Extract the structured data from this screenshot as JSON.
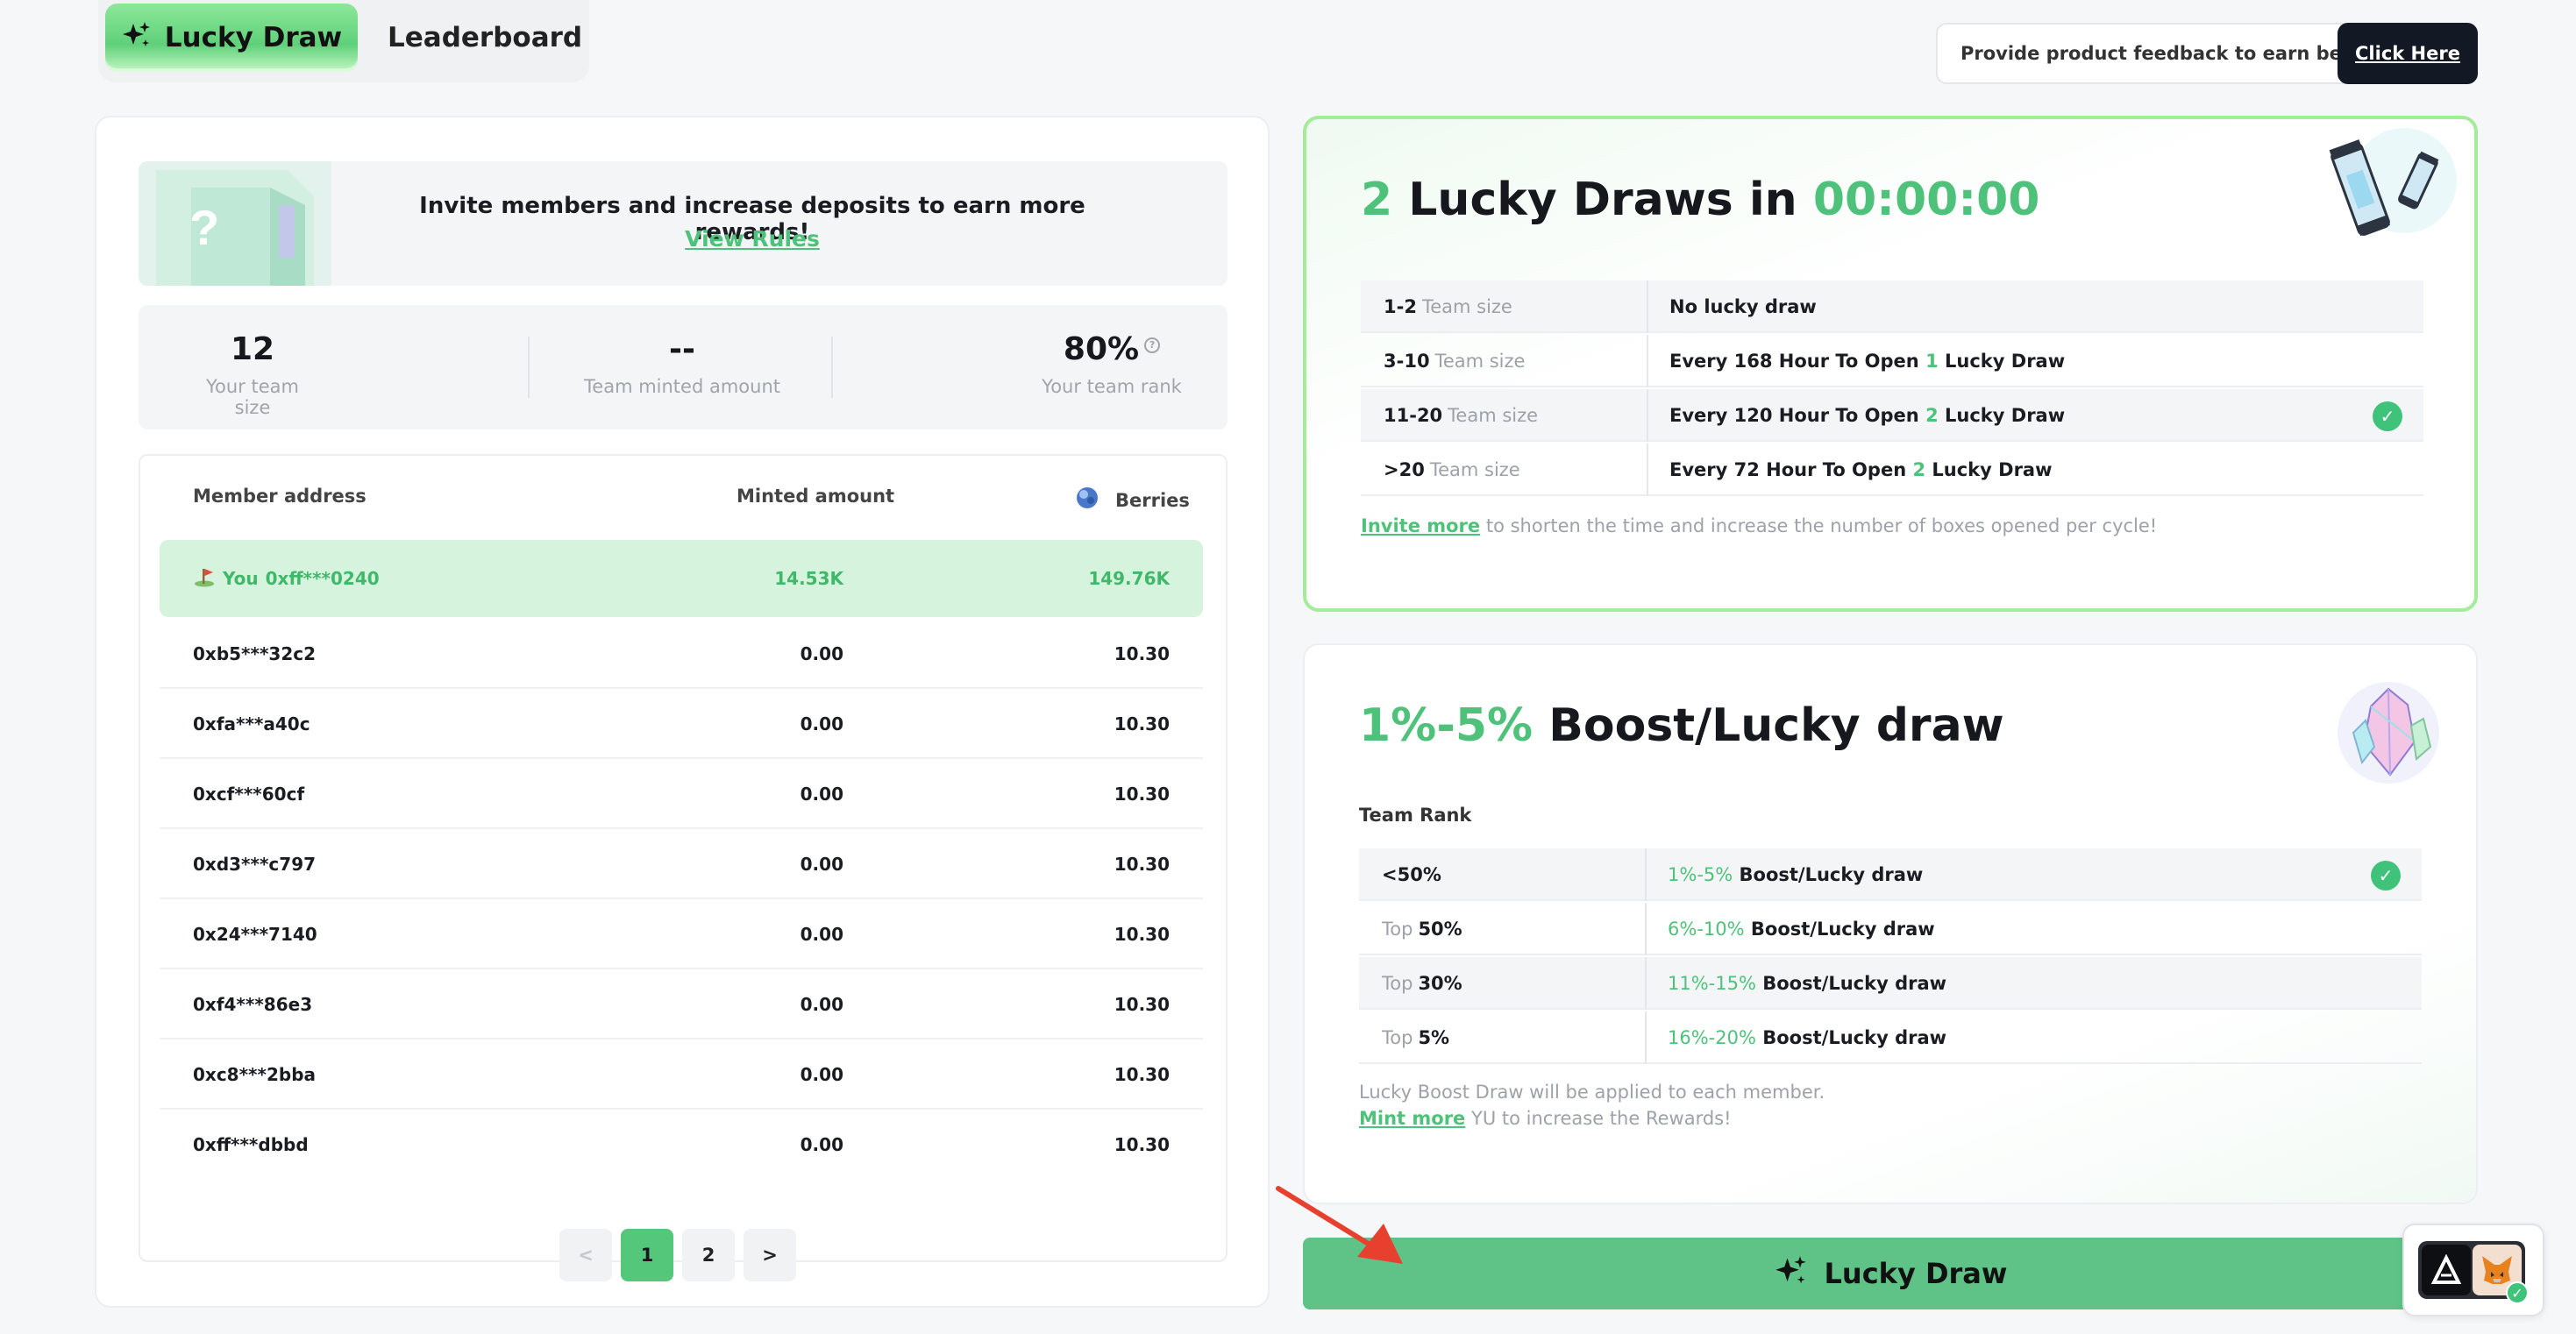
{
  "tabs": [
    {
      "label": "Lucky Draw",
      "icon": "sparkle-icon",
      "active": true
    },
    {
      "label": "Leaderboard",
      "active": false
    }
  ],
  "feedback": {
    "text": "Provide product feedback to earn berries!",
    "button": "Click Here"
  },
  "invite": {
    "text": "Invite members and increase deposits to earn more rewards!",
    "link": "View Rules"
  },
  "stats": [
    {
      "value": "12",
      "label": "Your team size"
    },
    {
      "value": "--",
      "label": "Team minted amount"
    },
    {
      "value": "80%",
      "label": "Your team rank",
      "icon": "info-icon"
    }
  ],
  "members_table": {
    "headers": {
      "address": "Member address",
      "minted": "Minted amount",
      "berries": "Berries",
      "berries_icon": "berry-icon"
    },
    "current_user": {
      "prefix": "You",
      "address": "0xff***0240",
      "minted": "14.53K",
      "berries": "149.76K",
      "icon": "flag-icon"
    },
    "rows": [
      {
        "address": "0xb5***32c2",
        "minted": "0.00",
        "berries": "10.30"
      },
      {
        "address": "0xfa***a40c",
        "minted": "0.00",
        "berries": "10.30"
      },
      {
        "address": "0xcf***60cf",
        "minted": "0.00",
        "berries": "10.30"
      },
      {
        "address": "0xd3***c797",
        "minted": "0.00",
        "berries": "10.30"
      },
      {
        "address": "0x24***7140",
        "minted": "0.00",
        "berries": "10.30"
      },
      {
        "address": "0xf4***86e3",
        "minted": "0.00",
        "berries": "10.30"
      },
      {
        "address": "0xc8***2bba",
        "minted": "0.00",
        "berries": "10.30"
      },
      {
        "address": "0xff***dbbd",
        "minted": "0.00",
        "berries": "10.30"
      }
    ],
    "pagination": {
      "prev": "<",
      "pages": [
        "1",
        "2"
      ],
      "current": "1",
      "next": ">"
    }
  },
  "lucky_draws": {
    "count": "2",
    "title_mid": "Lucky Draws in",
    "countdown": "00:00:00",
    "rows": [
      {
        "range": "1-2",
        "unit": "Team size",
        "before": "No lucky draw",
        "num": "",
        "after": "",
        "checked": false
      },
      {
        "range": "3-10",
        "unit": "Team size",
        "before": "Every 168 Hour To Open",
        "num": "1",
        "after": "Lucky Draw",
        "checked": false
      },
      {
        "range": "11-20",
        "unit": "Team size",
        "before": "Every 120 Hour To Open",
        "num": "2",
        "after": "Lucky Draw",
        "checked": true
      },
      {
        "range": ">20",
        "unit": "Team size",
        "before": "Every 72 Hour To Open",
        "num": "2",
        "after": "Lucky Draw",
        "checked": false
      }
    ],
    "note_link": "Invite more",
    "note_text": "to shorten the time and increase the number of boxes opened per cycle!"
  },
  "boost": {
    "range": "1%-5%",
    "title": "Boost/Lucky draw",
    "section_label": "Team Rank",
    "rows": [
      {
        "pre": "",
        "rank": "<50%",
        "pct": "1%-5%",
        "text": "Boost/Lucky draw",
        "checked": true
      },
      {
        "pre": "Top",
        "rank": "50%",
        "pct": "6%-10%",
        "text": "Boost/Lucky draw",
        "checked": false
      },
      {
        "pre": "Top",
        "rank": "30%",
        "pct": "11%-15%",
        "text": "Boost/Lucky draw",
        "checked": false
      },
      {
        "pre": "Top",
        "rank": "5%",
        "pct": "16%-20%",
        "text": "Boost/Lucky draw",
        "checked": false
      }
    ],
    "note_line1": "Lucky Boost Draw will be applied to each member.",
    "note_link": "Mint more",
    "note_line2": "YU to increase the Rewards!"
  },
  "lucky_button": {
    "label": "Lucky Draw",
    "icon": "sparkle-icon"
  },
  "colors": {
    "accent_green": "#4ec27a",
    "button_green": "#5fc388",
    "dark": "#121824"
  }
}
